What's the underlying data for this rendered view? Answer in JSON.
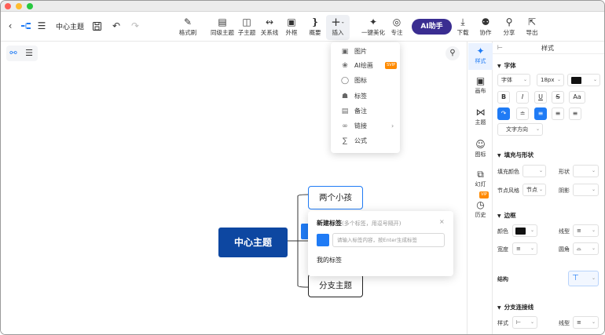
{
  "toolbar": {
    "title": "中心主题",
    "tools": [
      {
        "label": "格式刷",
        "icon": "format-painter-icon"
      },
      {
        "label": "同级主题",
        "icon": "sibling-topic-icon"
      },
      {
        "label": "子主题",
        "icon": "child-topic-icon"
      },
      {
        "label": "关系线",
        "icon": "relation-line-icon"
      },
      {
        "label": "外框",
        "icon": "boundary-icon"
      },
      {
        "label": "概要",
        "icon": "summary-icon"
      },
      {
        "label": "插入",
        "icon": "insert-plus-icon"
      },
      {
        "label": "一键美化",
        "icon": "beautify-wand-icon"
      },
      {
        "label": "专注",
        "icon": "focus-target-icon"
      },
      {
        "label": "下载",
        "icon": "download-icon"
      },
      {
        "label": "协作",
        "icon": "collaborate-icon"
      },
      {
        "label": "分享",
        "icon": "share-icon"
      },
      {
        "label": "导出",
        "icon": "export-icon"
      }
    ],
    "ai_label": "AI助手"
  },
  "insert_menu": [
    {
      "label": "图片",
      "icon": "image-icon"
    },
    {
      "label": "AI绘画",
      "icon": "palette-icon",
      "badge": "SVIP"
    },
    {
      "label": "图标",
      "icon": "emoji-icon"
    },
    {
      "label": "标签",
      "icon": "tag-icon"
    },
    {
      "label": "备注",
      "icon": "note-icon"
    },
    {
      "label": "链接",
      "icon": "link-icon"
    },
    {
      "label": "公式",
      "icon": "formula-icon"
    }
  ],
  "mindmap": {
    "root": "中心主题",
    "children": [
      "两个小孩",
      "分支主题"
    ]
  },
  "tag_popup": {
    "title": "新建标签",
    "hint": "(多个标签，用逗号隔开)",
    "placeholder": "请输入标签内容，按Enter生成标签",
    "my_tags": "我的标签",
    "close": "×"
  },
  "sidebar": [
    {
      "label": "样式",
      "icon": "style-icon",
      "active": true
    },
    {
      "label": "画布",
      "icon": "canvas-icon"
    },
    {
      "label": "主题",
      "icon": "theme-icon"
    },
    {
      "label": "图标",
      "icon": "emoji-icon"
    },
    {
      "label": "幻灯",
      "icon": "slides-icon"
    },
    {
      "label": "历史",
      "icon": "history-icon"
    }
  ],
  "sidebar_badge": "VIP",
  "panel": {
    "title": "样式",
    "font": {
      "section": "字体",
      "family": "字体",
      "size": "18px",
      "color": "#111111",
      "format_buttons": [
        "B",
        "I",
        "U",
        "S",
        "Aa"
      ],
      "direction": "文字方向"
    },
    "fill": {
      "section": "填充与形状",
      "fill_color": "填充颜色",
      "shape": "形状",
      "node_style": "节点风格",
      "node_style_value": "节点",
      "shadow": "阴影"
    },
    "border": {
      "section": "边框",
      "color": "颜色",
      "line_type": "线型",
      "width": "宽度",
      "corner": "圆角"
    },
    "structure": {
      "section": "结构"
    },
    "branch": {
      "section": "分支连接线",
      "style": "样式",
      "line_type": "线型"
    }
  },
  "colors": {
    "accent": "#1f7bf5",
    "root": "#0d47a1",
    "ai": "#3a2d91"
  }
}
